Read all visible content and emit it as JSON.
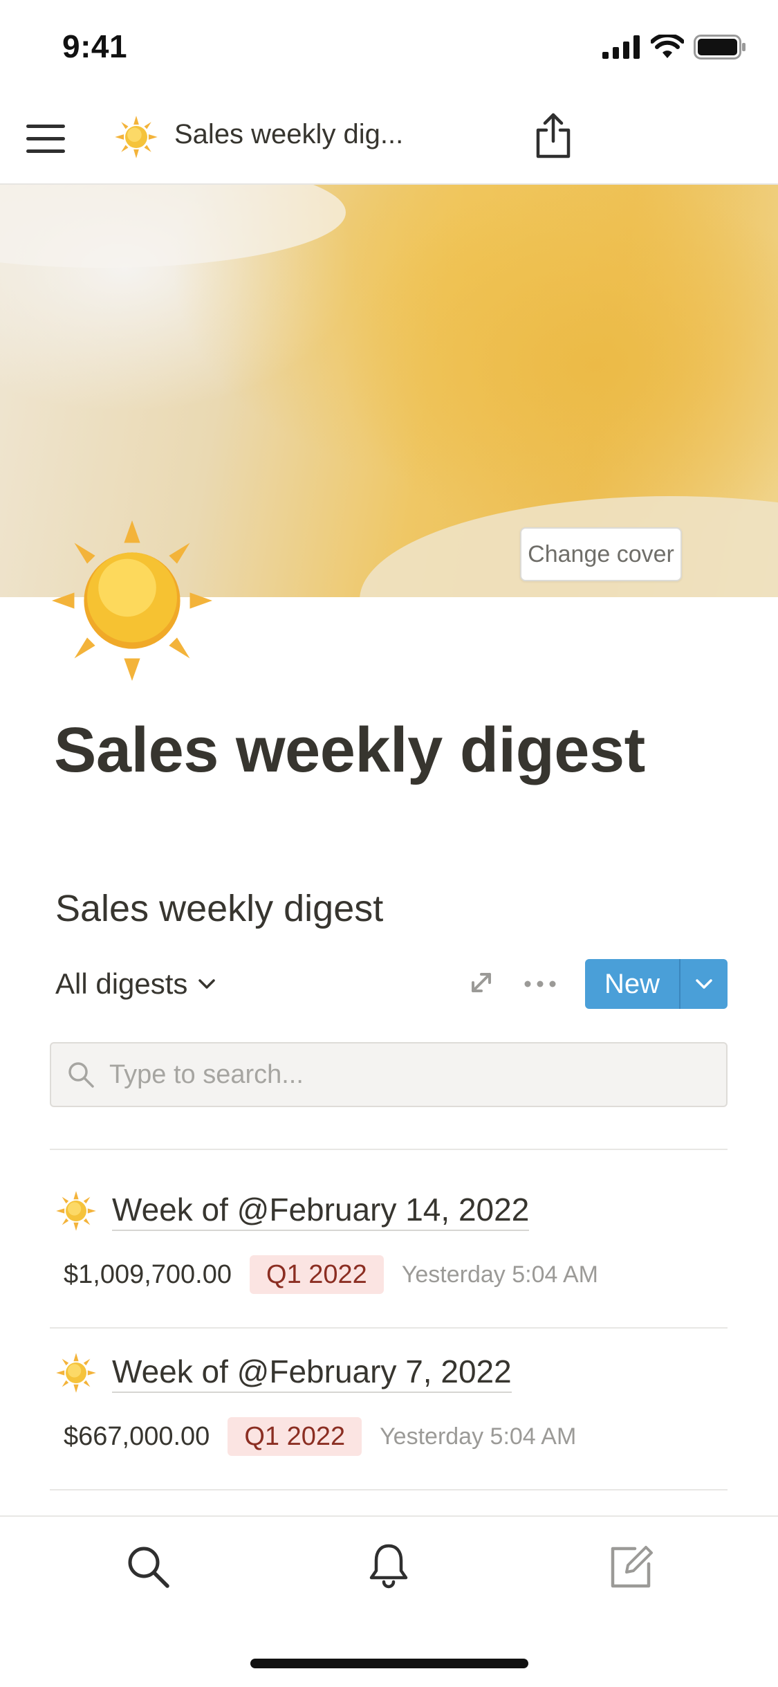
{
  "status_bar": {
    "time": "9:41"
  },
  "header": {
    "title": "Sales weekly dig...",
    "emoji": "sun-icon"
  },
  "cover": {
    "change_cover_label": "Change cover"
  },
  "page": {
    "title": "Sales weekly digest"
  },
  "database": {
    "title": "Sales weekly digest",
    "view_label": "All digests",
    "new_button_label": "New",
    "search_placeholder": "Type to search...",
    "rows": [
      {
        "title": "Week of @February 14, 2022",
        "amount": "$1,009,700.00",
        "tag": "Q1 2022",
        "time": "Yesterday 5:04 AM"
      },
      {
        "title": "Week of @February 7, 2022",
        "amount": "$667,000.00",
        "tag": "Q1 2022",
        "time": "Yesterday 5:04 AM"
      }
    ]
  },
  "colors": {
    "accent": "#4a9fd8",
    "text": "#37352f",
    "tag_bg": "#fbe4e2",
    "tag_text": "#8b2e22",
    "cover_yellow": "#edbf55"
  },
  "bottom_tabs": [
    "search-icon",
    "bell-icon",
    "compose-icon"
  ]
}
